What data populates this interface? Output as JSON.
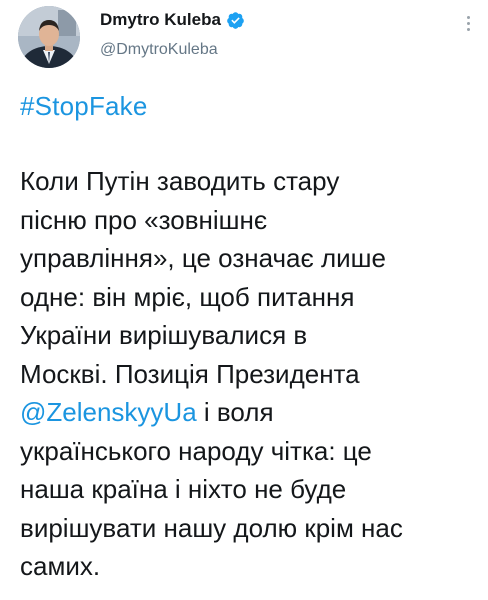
{
  "author": {
    "display_name": "Dmytro Kuleba",
    "handle": "@DmytroKuleba",
    "verified": true,
    "avatar": "profile-photo"
  },
  "icons": {
    "verified": "verified-badge-icon",
    "more": "more-options-icon"
  },
  "colors": {
    "link": "#1b95e0",
    "text": "#14171a",
    "secondary": "#657786",
    "verified": "#1da1f2"
  },
  "tweet": {
    "hashtag": "#StopFake",
    "lines": [
      "Коли Путін заводить стару",
      "пісню про «зовнішнє",
      "управління», це означає лише",
      "одне: він мріє, щоб питання",
      "України вирішувалися в",
      "Москві. Позиція Президента"
    ],
    "mention": "@ZelenskyyUa",
    "mention_suffix": " і воля",
    "lines_after": [
      "українського народу чітка: це",
      "наша країна і ніхто не буде",
      "вирішувати нашу долю крім нас",
      "самих."
    ]
  }
}
